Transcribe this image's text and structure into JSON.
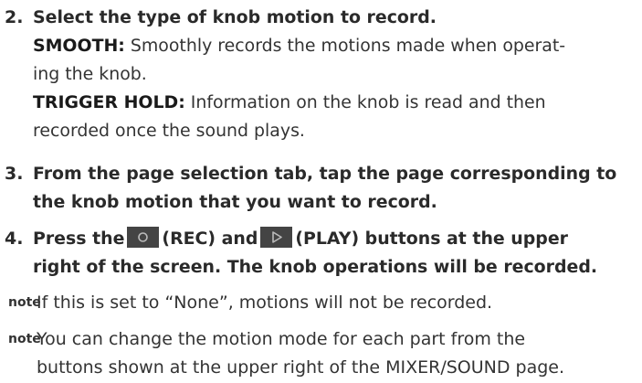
{
  "steps": [
    {
      "number": "2.",
      "title": "Select the type of knob motion to record.",
      "options": [
        {
          "keyword": "SMOOTH:",
          "line1": " Smoothly records the motions made when operat-",
          "line2": "ing the knob."
        },
        {
          "keyword": "TRIGGER HOLD:",
          "line1": " Information on the knob is read and then",
          "line2": "recorded once the sound plays."
        }
      ]
    },
    {
      "number": "3.",
      "line1": "From the page selection tab, tap the page corresponding to",
      "line2": "the knob motion that you want to record."
    },
    {
      "number": "4.",
      "before_rec": "Press the",
      "rec_label": "(REC) and",
      "play_label": "(PLAY) buttons at the upper",
      "line2": "right of the screen. The knob operations will be recorded."
    }
  ],
  "icons": {
    "rec": "record-button-icon",
    "play": "play-button-icon"
  },
  "notes": [
    {
      "tag": "note",
      "line1": "If this is set to “None”, motions will not be recorded."
    },
    {
      "tag": "note",
      "line1": "You can change the motion mode for each part from the",
      "line2": "buttons shown at the upper right of the MIXER/SOUND page."
    }
  ],
  "colors": {
    "text": "#1a1a1a",
    "button_bg": "#444444",
    "button_glyph": "#bbbbbb"
  }
}
